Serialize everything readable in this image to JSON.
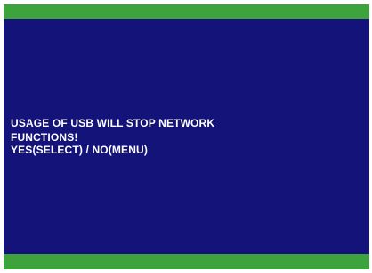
{
  "screen": {
    "colors": {
      "background": "#14137a",
      "bars": "#3fa33d",
      "text": "#ffffff"
    }
  },
  "dialog": {
    "warning": "USAGE OF USB WILL STOP NETWORK FUNCTIONS!",
    "options": "YES(SELECT) / NO(MENU)"
  }
}
